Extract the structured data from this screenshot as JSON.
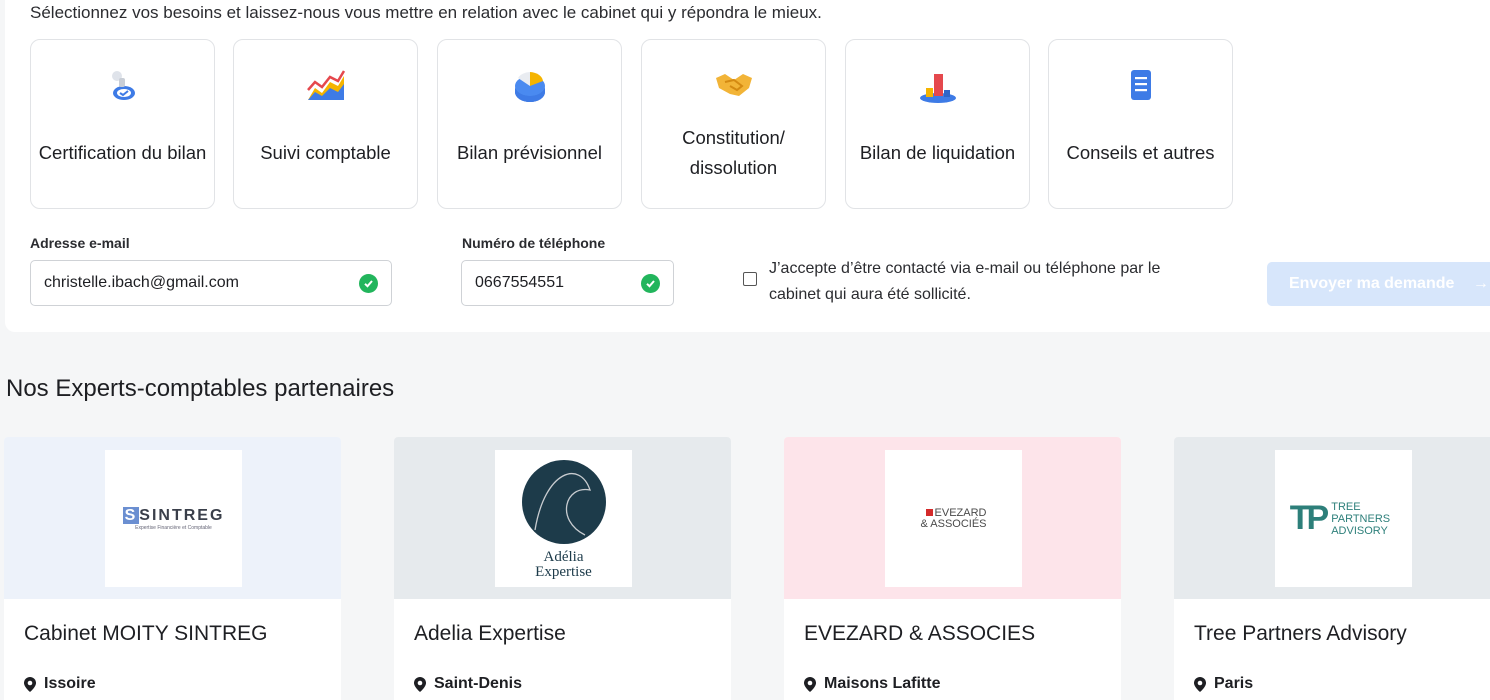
{
  "intro": "Sélectionnez vos besoins et laissez-nous vous mettre en relation avec le cabinet qui y répondra le mieux.",
  "needs": [
    {
      "label": "Certification du bilan",
      "icon": "certificate-badge-icon"
    },
    {
      "label": "Suivi comptable",
      "icon": "chart-icon"
    },
    {
      "label": "Bilan prévisionnel",
      "icon": "pie-chart-icon"
    },
    {
      "label": "Constitution/ dissolution",
      "icon": "handshake-icon"
    },
    {
      "label": "Bilan de liquidation",
      "icon": "stack-bars-icon"
    },
    {
      "label": "Conseils et autres",
      "icon": "document-icon"
    }
  ],
  "form": {
    "email_label": "Adresse e-mail",
    "email_value": "christelle.ibach@gmail.com",
    "phone_label": "Numéro de téléphone",
    "phone_value": "0667554551",
    "consent_text": "J’accepte d’être contacté via e-mail ou téléphone par le cabinet qui aura été sollicité.",
    "submit_label": "Envoyer ma demande",
    "submit_arrow": "→"
  },
  "partners_title": "Nos Experts-comptables partenaires",
  "partners": [
    {
      "name": "Cabinet MOITY SINTREG",
      "city": "Issoire",
      "band_color": "#edf2fa",
      "logo_text": "SINTREG",
      "logo_sub": "Expertise Financière et Comptable"
    },
    {
      "name": "Adelia Expertise",
      "city": "Saint-Denis",
      "band_color": "#e6eaed",
      "logo_text": "Adélia",
      "logo_sub": "Expertise"
    },
    {
      "name": "EVEZARD & ASSOCIES",
      "city": "Maisons Lafitte",
      "band_color": "#fde4ea",
      "logo_text": "EVEZARD",
      "logo_sub": "& ASSOCIÉS"
    },
    {
      "name": "Tree Partners Advisory",
      "city": "Paris",
      "band_color": "#e6eaed",
      "logo_text": "TREE PARTNERS ADVISORY",
      "logo_sub": "TP"
    }
  ],
  "colors": {
    "accent": "#3d7ee8",
    "valid": "#22b55c",
    "button_disabled": "#d7e6fb"
  }
}
